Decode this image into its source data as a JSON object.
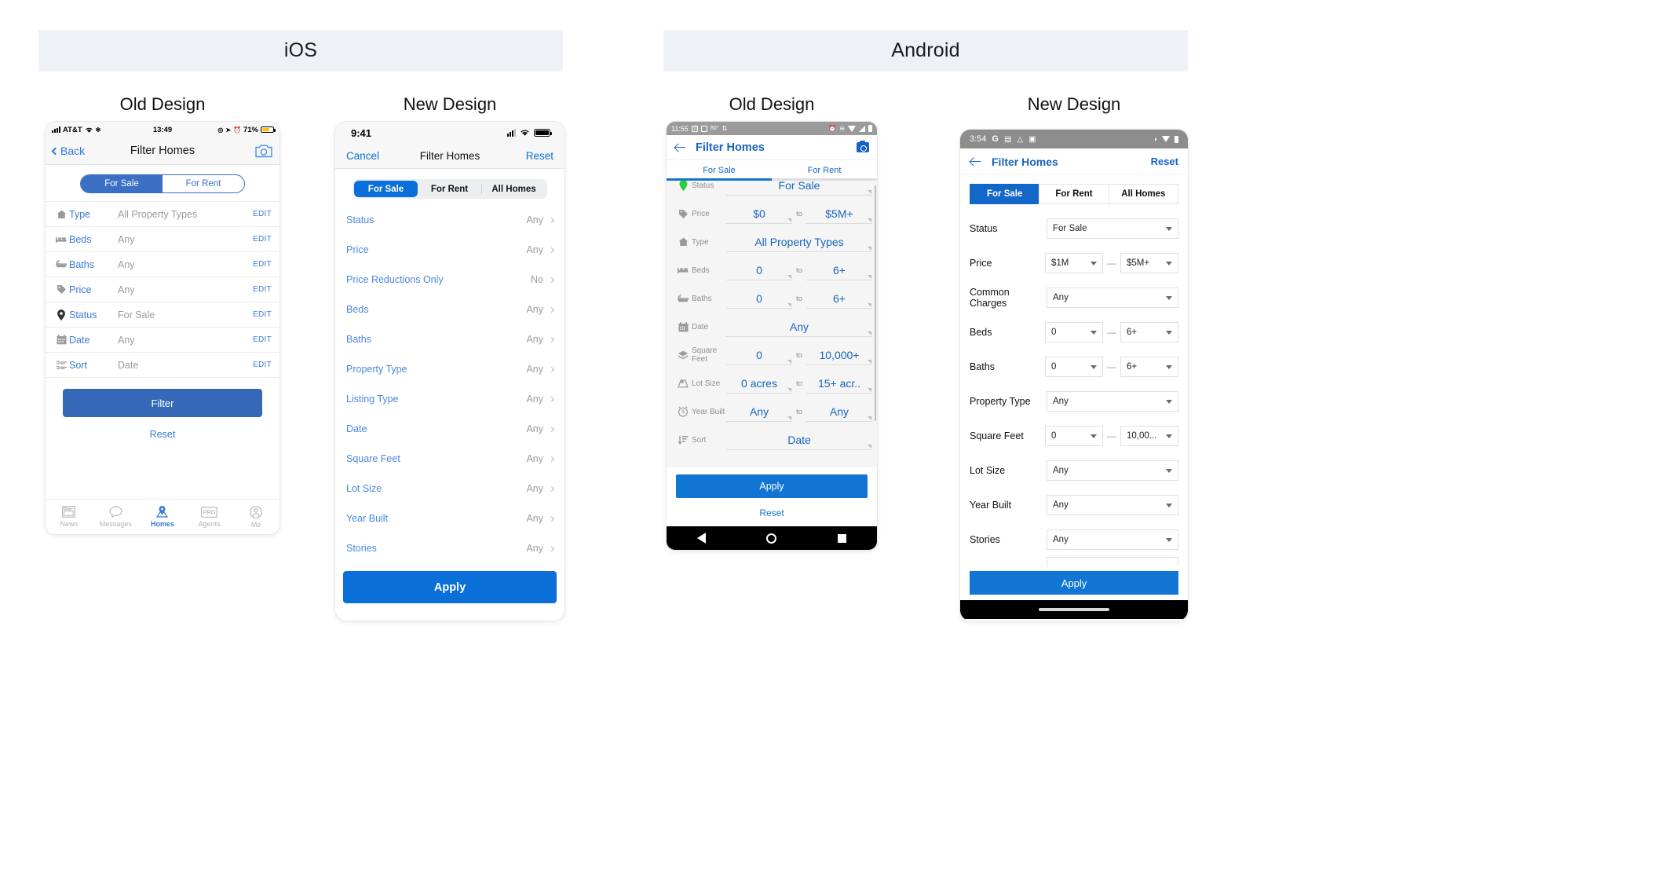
{
  "platforms": [
    {
      "name": "iOS"
    },
    {
      "name": "Android"
    }
  ],
  "captions": {
    "old": "Old Design",
    "new": "New Design"
  },
  "ios_old": {
    "status_bar": {
      "carrier": "AT&T",
      "time": "13:49",
      "battery_percent": "71%"
    },
    "nav": {
      "back_label": "Back",
      "title": "Filter Homes",
      "camera_icon": "camera-icon"
    },
    "segmented": {
      "options": [
        "For Sale",
        "For Rent"
      ],
      "selected": "For Sale"
    },
    "rows": [
      {
        "icon": "home-icon",
        "label": "Type",
        "value": "All Property Types",
        "action": "EDIT"
      },
      {
        "icon": "bed-icon",
        "label": "Beds",
        "value": "Any",
        "action": "EDIT"
      },
      {
        "icon": "bathtub-icon",
        "label": "Baths",
        "value": "Any",
        "action": "EDIT"
      },
      {
        "icon": "tag-icon",
        "label": "Price",
        "value": "Any",
        "action": "EDIT"
      },
      {
        "icon": "pin-icon",
        "label": "Status",
        "value": "For Sale",
        "action": "EDIT"
      },
      {
        "icon": "calendar-icon",
        "label": "Date",
        "value": "Any",
        "action": "EDIT"
      },
      {
        "icon": "sort-icon",
        "label": "Sort",
        "value": "Date",
        "action": "EDIT"
      }
    ],
    "filter_button": "Filter",
    "reset_link": "Reset",
    "tabbar": [
      {
        "icon": "news-icon",
        "label": "News",
        "active": false
      },
      {
        "icon": "messages-icon",
        "label": "Messages",
        "active": false
      },
      {
        "icon": "pin-icon",
        "label": "Homes",
        "active": true
      },
      {
        "icon": "pro-icon",
        "label": "Agents",
        "active": false
      },
      {
        "icon": "person-icon",
        "label": "Me",
        "active": false
      }
    ]
  },
  "ios_new": {
    "status_bar": {
      "time": "9:41"
    },
    "nav": {
      "cancel_label": "Cancel",
      "title": "Filter Homes",
      "reset_label": "Reset"
    },
    "segmented": {
      "options": [
        "For Sale",
        "For Rent",
        "All Homes"
      ],
      "selected": "For Sale"
    },
    "rows": [
      {
        "label": "Status",
        "value": "Any"
      },
      {
        "label": "Price",
        "value": "Any"
      },
      {
        "label": "Price Reductions Only",
        "value": "No"
      },
      {
        "label": "Beds",
        "value": "Any"
      },
      {
        "label": "Baths",
        "value": "Any"
      },
      {
        "label": "Property Type",
        "value": "Any"
      },
      {
        "label": "Listing Type",
        "value": "Any"
      },
      {
        "label": "Date",
        "value": "Any"
      },
      {
        "label": "Square Feet",
        "value": "Any"
      },
      {
        "label": "Lot Size",
        "value": "Any"
      },
      {
        "label": "Year Built",
        "value": "Any"
      },
      {
        "label": "Stories",
        "value": "Any"
      }
    ],
    "apply_button": "Apply"
  },
  "android_old": {
    "status_bar": {
      "time": "11:55",
      "weather": "80°"
    },
    "appbar": {
      "title": "Filter Homes",
      "back_icon": "arrow-left-icon",
      "camera_icon": "camera-icon"
    },
    "tabs": {
      "options": [
        "For Sale",
        "For Rent"
      ],
      "selected": "For Sale"
    },
    "rows": [
      {
        "icon": "pin-icon",
        "label": "Status",
        "single": "For Sale",
        "from": "",
        "to": ""
      },
      {
        "icon": "tag-icon",
        "label": "Price",
        "single": "",
        "from": "$0",
        "to": "$5M+"
      },
      {
        "icon": "home-icon",
        "label": "Type",
        "single": "All Property Types",
        "from": "",
        "to": ""
      },
      {
        "icon": "bed-icon",
        "label": "Beds",
        "single": "",
        "from": "0",
        "to": "6+"
      },
      {
        "icon": "bathtub-icon",
        "label": "Baths",
        "single": "",
        "from": "0",
        "to": "6+"
      },
      {
        "icon": "calendar-icon",
        "label": "Date",
        "single": "Any",
        "from": "",
        "to": ""
      },
      {
        "icon": "layers-icon",
        "label": "Square Feet",
        "single": "",
        "from": "0",
        "to": "10,000+"
      },
      {
        "icon": "lot-icon",
        "label": "Lot Size",
        "single": "",
        "from": "0 acres",
        "to": "15+ acr.."
      },
      {
        "icon": "clock-icon",
        "label": "Year Built",
        "single": "",
        "from": "Any",
        "to": "Any"
      },
      {
        "icon": "sort-icon",
        "label": "Sort",
        "single": "Date",
        "from": "",
        "to": ""
      }
    ],
    "range_separator": "to",
    "apply_button": "Apply",
    "reset_link": "Reset",
    "navbar": [
      "back-triangle-icon",
      "home-circle-icon",
      "recents-square-icon"
    ]
  },
  "android_new": {
    "status_bar": {
      "time": "3:54"
    },
    "appbar": {
      "title": "Filter Homes",
      "back_icon": "arrow-left-icon",
      "reset_label": "Reset"
    },
    "segmented": {
      "options": [
        "For Sale",
        "For Rent",
        "All Homes"
      ],
      "selected": "For Sale"
    },
    "rows": [
      {
        "label": "Common Charges",
        "type": "single",
        "value": "Any"
      },
      {
        "label": "Status",
        "type": "single",
        "value": "For Sale"
      },
      {
        "label": "Price",
        "type": "range",
        "from": "$1M",
        "to": "$5M+"
      },
      {
        "label": "Common Charges",
        "type": "single",
        "value": "Any"
      },
      {
        "label": "Beds",
        "type": "range",
        "from": "0",
        "to": "6+"
      },
      {
        "label": "Baths",
        "type": "range",
        "from": "0",
        "to": "6+"
      },
      {
        "label": "Property Type",
        "type": "single",
        "value": "Any"
      },
      {
        "label": "Square Feet",
        "type": "range",
        "from": "0",
        "to": "10,00..."
      },
      {
        "label": "Lot Size",
        "type": "single",
        "value": "Any"
      },
      {
        "label": "Year Built",
        "type": "single",
        "value": "Any"
      },
      {
        "label": "Stories",
        "type": "single",
        "value": "Any"
      }
    ],
    "range_separator": "—",
    "apply_button": "Apply"
  },
  "colors": {
    "ios_blue": "#0a6fd8",
    "ios_old_blue": "#3a7bd5",
    "android_blue": "#1176d3",
    "android_title_blue": "#1565C0",
    "band_bg": "#eef2f7",
    "muted": "#9b9b9b"
  }
}
